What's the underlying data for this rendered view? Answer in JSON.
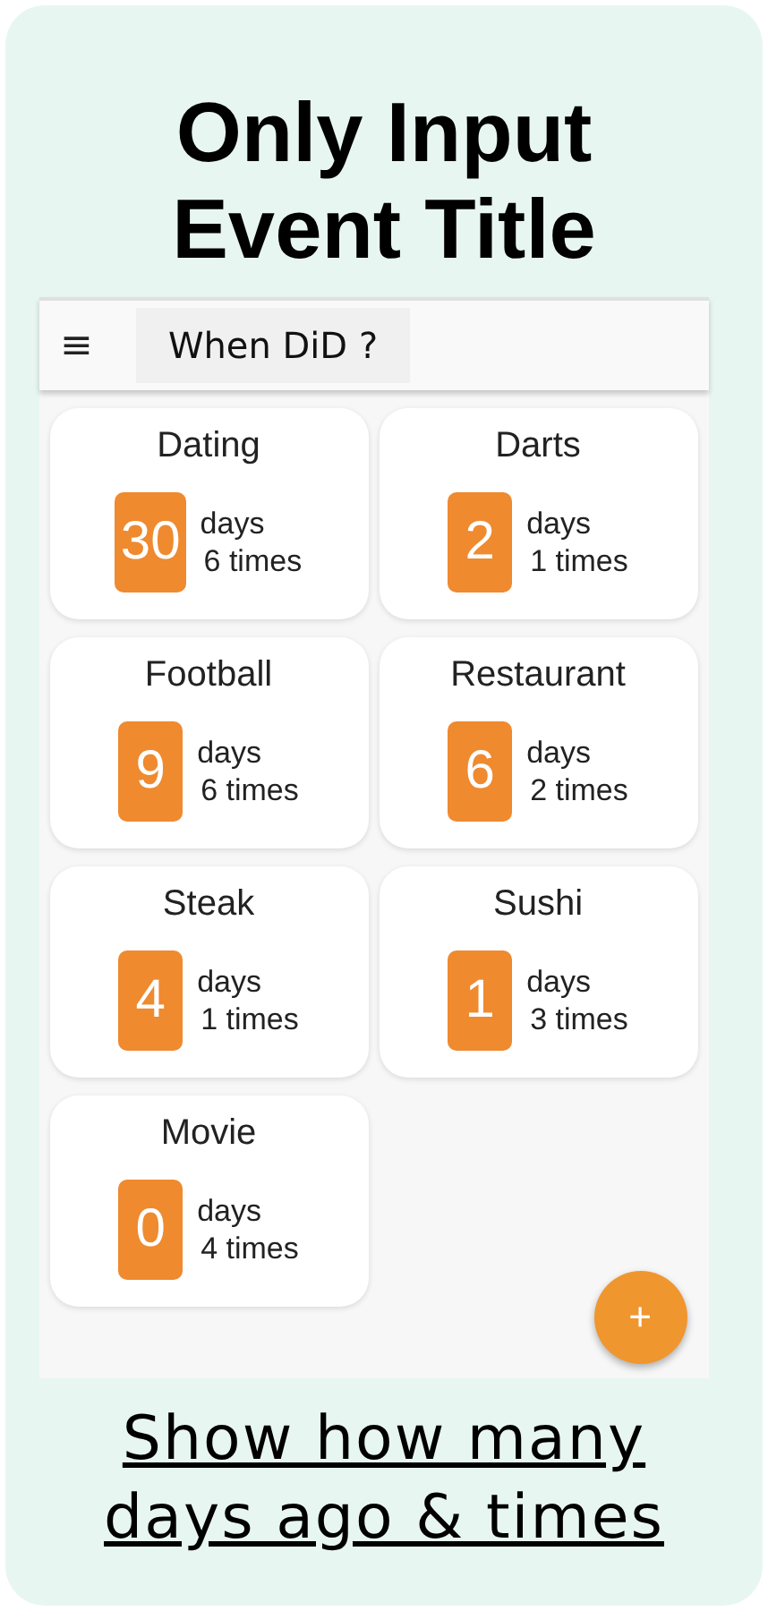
{
  "headline": [
    "Only Input",
    "Event Title"
  ],
  "app_bar": {
    "menu": "≡",
    "title": "When DiD ?"
  },
  "events": [
    {
      "title": "Dating",
      "days": "30",
      "unit": "days",
      "times": "6 times"
    },
    {
      "title": "Darts",
      "days": "2",
      "unit": "days",
      "times": "1 times"
    },
    {
      "title": "Football",
      "days": "9",
      "unit": "days",
      "times": "6 times"
    },
    {
      "title": "Restaurant",
      "days": "6",
      "unit": "days",
      "times": "2 times"
    },
    {
      "title": "Steak",
      "days": "4",
      "unit": "days",
      "times": "1 times"
    },
    {
      "title": "Sushi",
      "days": "1",
      "unit": "days",
      "times": "3 times"
    },
    {
      "title": "Movie",
      "days": "0",
      "unit": "days",
      "times": "4 times"
    }
  ],
  "fab": "+",
  "caption": [
    "Show how many",
    "days ago & times"
  ]
}
